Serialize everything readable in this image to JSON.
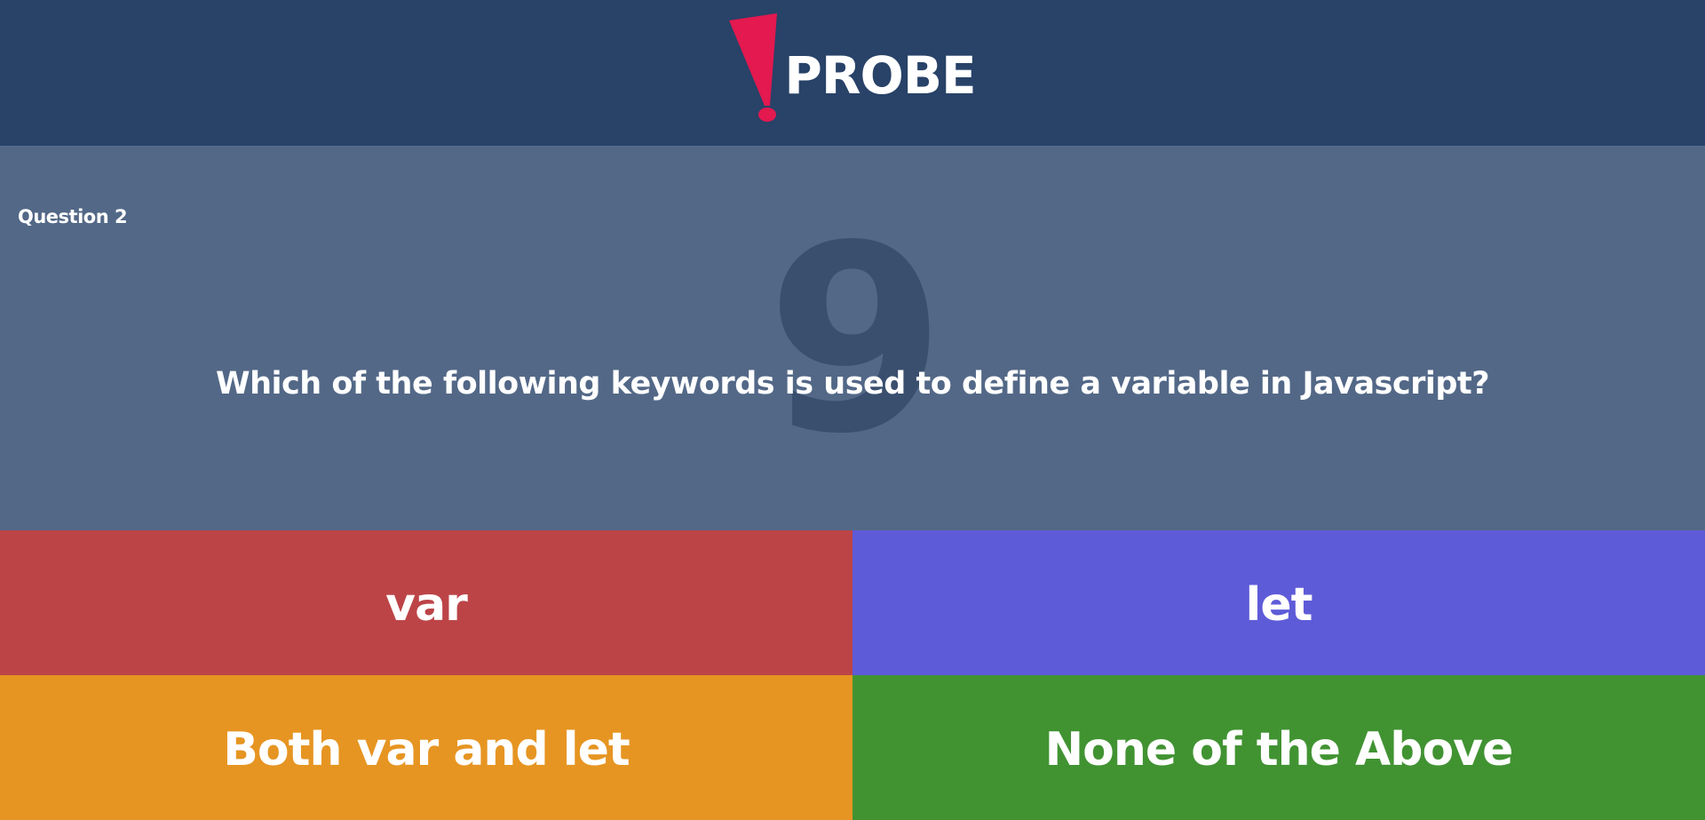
{
  "header": {
    "logo_text": "PROBE",
    "logo_icon": "exclamation-icon",
    "background": "#284268",
    "accent": "#e3194f"
  },
  "question": {
    "label": "Question 2",
    "timer": "9",
    "text": "Which of the following keywords is used to define a variable in Javascript?"
  },
  "answers": [
    {
      "label": "var",
      "color": "#bc4447"
    },
    {
      "label": "let",
      "color": "#5e5bd8"
    },
    {
      "label": "Both var and let",
      "color": "#e69522"
    },
    {
      "label": "None of the Above",
      "color": "#419332"
    }
  ]
}
